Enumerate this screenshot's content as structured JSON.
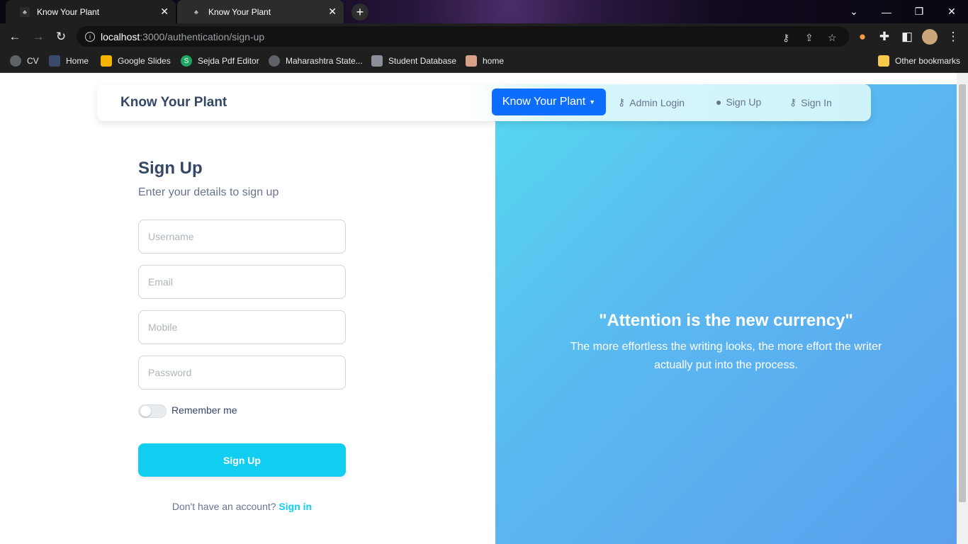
{
  "browser": {
    "tabs": [
      {
        "title": "Know Your Plant",
        "active": true
      },
      {
        "title": "Know Your Plant",
        "active": false
      }
    ],
    "url_host": "localhost",
    "url_path": ":3000/authentication/sign-up",
    "bookmarks": [
      {
        "label": "CV",
        "icon": "globe-icon"
      },
      {
        "label": "Home",
        "icon": "home-icon"
      },
      {
        "label": "Google Slides",
        "icon": "slides-icon",
        "color": "#f4b400"
      },
      {
        "label": "Sejda Pdf Editor",
        "icon": "sejda-icon",
        "color": "#1fa463"
      },
      {
        "label": "Maharashtra State...",
        "icon": "globe-icon"
      },
      {
        "label": "Student Database",
        "icon": "database-icon"
      },
      {
        "label": "home",
        "icon": "home-icon"
      }
    ],
    "other_bookmarks": "Other bookmarks"
  },
  "navbar": {
    "brand": "Know Your Plant",
    "dropdown_label": "Know Your Plant",
    "links": [
      {
        "label": "Admin Login",
        "icon": "key-icon"
      },
      {
        "label": "Sign Up",
        "icon": "user-circle-icon"
      },
      {
        "label": "Sign In",
        "icon": "key-icon"
      }
    ]
  },
  "form": {
    "title": "Sign Up",
    "subtitle": "Enter your details to sign up",
    "username_placeholder": "Username",
    "email_placeholder": "Email",
    "mobile_placeholder": "Mobile",
    "password_placeholder": "Password",
    "remember_label": "Remember me",
    "remember_checked": false,
    "submit_label": "Sign Up",
    "footer_text": "Don't have an account?",
    "footer_link": "Sign in"
  },
  "hero": {
    "quote": "\"Attention is the new currency\"",
    "body": "The more effortless the writing looks, the more effort the writer actually put into the process."
  },
  "colors": {
    "primary": "#0d6efd",
    "info": "#11cdef",
    "heading": "#344767",
    "text": "#67748e"
  }
}
